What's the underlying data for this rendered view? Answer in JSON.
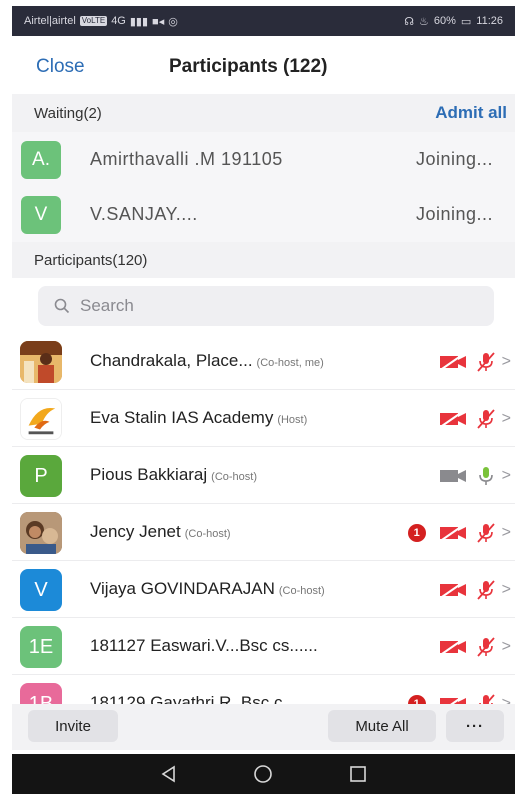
{
  "status_bar": {
    "carrier": "Airtel|airtel",
    "chip": "VoLTE",
    "signal": "4G",
    "battery": "60%",
    "time": "11:26"
  },
  "header": {
    "close_label": "Close",
    "title": "Participants (122)"
  },
  "waiting": {
    "heading": "Waiting(2)",
    "admit_all_label": "Admit all",
    "items": [
      {
        "initial": "A.",
        "name": "Amirthavalli .M   191105",
        "status": "Joining..."
      },
      {
        "initial": "V",
        "name": "V.SANJAY....",
        "status": "Joining..."
      }
    ]
  },
  "participants": {
    "heading": "Participants(120)",
    "search_placeholder": "Search",
    "items": [
      {
        "initial": "",
        "name": "Chandrakala, Place...",
        "role": "(Co-host, me)",
        "badge": "",
        "video": "off",
        "audio": "off"
      },
      {
        "initial": "",
        "name": "Eva Stalin IAS Academy",
        "role": "(Host)",
        "badge": "",
        "video": "off",
        "audio": "off"
      },
      {
        "initial": "P",
        "name": "Pious Bakkiaraj",
        "role": "(Co-host)",
        "badge": "",
        "video": "on",
        "audio": "on"
      },
      {
        "initial": "",
        "name": "Jency Jenet",
        "role": "(Co-host)",
        "badge": "1",
        "video": "off",
        "audio": "off"
      },
      {
        "initial": "V",
        "name": "Vijaya GOVINDARAJAN",
        "role": "(Co-host)",
        "badge": "",
        "video": "off",
        "audio": "off"
      },
      {
        "initial": "1E",
        "name": "181127 Easwari.V...Bsc cs......",
        "role": "",
        "badge": "",
        "video": "off",
        "audio": "off"
      },
      {
        "initial": "1B",
        "name": "181129,Gayathri.R, Bsc c...",
        "role": "",
        "badge": "1",
        "video": "off",
        "audio": "off"
      }
    ]
  },
  "toolbar": {
    "invite_label": "Invite",
    "mute_all_label": "Mute All",
    "more_label": "···"
  },
  "colors": {
    "accent_blue": "#2d6db5",
    "muted_red": "#e8343c",
    "active_green": "#7ac23a"
  }
}
